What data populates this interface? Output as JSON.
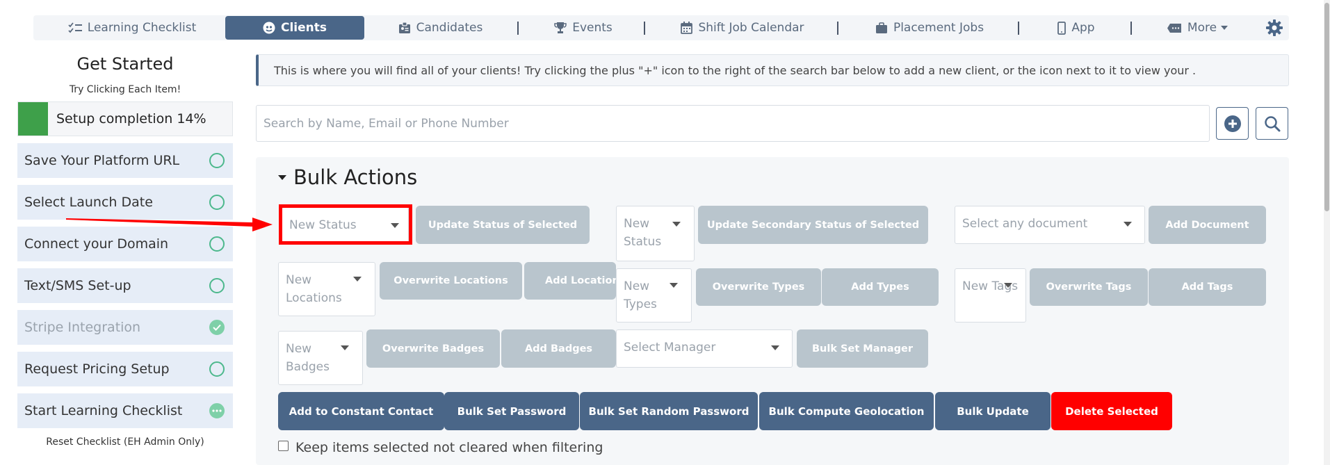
{
  "nav": {
    "items": [
      {
        "label": "Learning Checklist",
        "icon": "checklist-icon"
      },
      {
        "label": "Clients",
        "icon": "user-circle-icon",
        "active": true
      },
      {
        "label": "Candidates",
        "icon": "id-badge-icon"
      },
      {
        "label": "Events",
        "icon": "trophy-icon"
      },
      {
        "label": "Shift Job Calendar",
        "icon": "calendar-icon"
      },
      {
        "label": "Placement Jobs",
        "icon": "briefcase-icon"
      },
      {
        "label": "App",
        "icon": "phone-icon"
      },
      {
        "label": "More",
        "icon": "ticket-icon"
      }
    ],
    "settings_icon": "gear-icon"
  },
  "sidebar": {
    "title": "Get Started",
    "subtitle": "Try Clicking Each Item!",
    "progress_label": "Setup completion 14%",
    "progress_value": 0.14,
    "tasks": [
      {
        "label": "Save Your Platform URL",
        "status": "pending"
      },
      {
        "label": "Select Launch Date",
        "status": "pending"
      },
      {
        "label": "Connect your Domain",
        "status": "pending"
      },
      {
        "label": "Text/SMS Set-up",
        "status": "pending"
      },
      {
        "label": "Stripe Integration",
        "status": "complete"
      },
      {
        "label": "Request Pricing Setup",
        "status": "pending"
      },
      {
        "label": "Start Learning Checklist",
        "status": "in-progress"
      }
    ],
    "reset_label": "Reset Checklist (EH Admin Only)"
  },
  "main": {
    "info_text": "This is where you will find all of your clients! Try clicking the plus \"+\" icon to the right of the search bar below to add a new client, or the icon next to it to view your .",
    "search_placeholder": "Search by Name, Email or Phone Number",
    "bulk_title": "Bulk Actions",
    "status_select": "New Status",
    "update_status_label": "Update Status of Selected",
    "secondary_status_select": "New Status",
    "update_secondary_label": "Update Secondary Status of Selected",
    "document_select": "Select any document",
    "add_document_label": "Add Document",
    "locations_select": "New Locations",
    "overwrite_locations_label": "Overwrite Locations",
    "add_locations_label": "Add Locations",
    "types_select": "New Types",
    "overwrite_types_label": "Overwrite Types",
    "add_types_label": "Add Types",
    "tags_select": "New Tags",
    "overwrite_tags_label": "Overwrite Tags",
    "add_tags_label": "Add Tags",
    "badges_select": "New Badges",
    "overwrite_badges_label": "Overwrite Badges",
    "add_badges_label": "Add Badges",
    "manager_select": "Select Manager",
    "bulk_set_manager_label": "Bulk Set Manager",
    "action_buttons": [
      "Add to Constant Contact",
      "Bulk Set Password",
      "Bulk Set Random Password",
      "Bulk Compute Geolocation",
      "Bulk Update",
      "Delete Selected"
    ],
    "keep_selected_label": "Keep items selected not cleared when filtering"
  },
  "colors": {
    "primary": "#4a6688",
    "disabled_button": "#b9c5cd",
    "danger": "#ff0000",
    "success": "#3ea04a",
    "annotation": "#ff0000"
  }
}
